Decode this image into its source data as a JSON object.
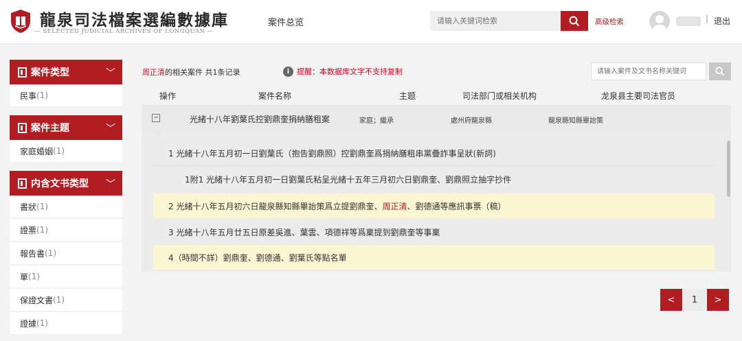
{
  "header": {
    "title": "龍泉司法檔案選編數據庫",
    "subtitle": "— SELECTED JUDICIAL ARCHIVES OF LONGQUAN —",
    "nav_overview": "案件总览",
    "search_placeholder": "请输入关键词检索",
    "advanced_search": "高级检索",
    "separator": "|",
    "logout": "退出",
    "brand_color": "#b01d23"
  },
  "sidebar": {
    "groups": [
      {
        "title": "案件类型",
        "items": [
          {
            "label": "民事",
            "count": "(1)"
          }
        ]
      },
      {
        "title": "案件主题",
        "items": [
          {
            "label": "家庭婚姻",
            "count": "(1)"
          }
        ]
      },
      {
        "title": "内含文书类型",
        "items": [
          {
            "label": "書狀",
            "count": "(1)"
          },
          {
            "label": "證票",
            "count": "(1)"
          },
          {
            "label": "報告書",
            "count": "(1)"
          },
          {
            "label": "單",
            "count": "(1)"
          },
          {
            "label": "保證文書",
            "count": "(1)"
          },
          {
            "label": "證據",
            "count": "(1)"
          }
        ]
      }
    ]
  },
  "main": {
    "crumb_name": "周正清",
    "crumb_text": "的相关案件  共1条记录",
    "notice": "提醒：本数据库文字不支持复制",
    "case_search_placeholder": "请输入案件及文书名称关键词",
    "table_headers": [
      "操作",
      "案件名称",
      "主题",
      "司法部门或相关机构",
      "龙泉县主要司法官员"
    ],
    "case": {
      "toggle": "−",
      "name": "光緒十八年劉葉氏控劉鼎奎捐納膳租案",
      "theme": "家庭；繼承",
      "dept": "處州府龍泉縣",
      "official": "龍泉縣知縣畢詒策"
    },
    "documents": [
      {
        "pre": "1 光緒十八年五月初一日劉葉氏（抱告劉鼎照）控劉鼎奎爲捐納膳租串黨疊詐事呈狀(新詞)",
        "mid": "",
        "post": "",
        "highlight": false
      },
      {
        "pre": "1附1 光緒十八年五月初一日劉葉氏粘呈光緒十五年三月初六日劉鼎奎、劉鼎照立抽字抄件",
        "mid": "",
        "post": "",
        "highlight": false
      },
      {
        "pre": "2 光緒十八年五月初六日龍泉縣知縣畢詒策爲立提劉鼎奎、",
        "mid": "周正清",
        "post": "、劉德通等應訊事票（稿）",
        "highlight": true
      },
      {
        "pre": "3 光緒十八年五月廿五日原差吳進、葉雲、項德祥等爲稟提到劉鼎奎等事稟",
        "mid": "",
        "post": "",
        "highlight": false
      },
      {
        "pre": "4（時間不詳）劉鼎奎、劉德通、劉葉氏等點名單",
        "mid": "",
        "post": "",
        "highlight": true
      }
    ]
  },
  "pager": {
    "prev": "<",
    "page": "1",
    "next": ">"
  }
}
